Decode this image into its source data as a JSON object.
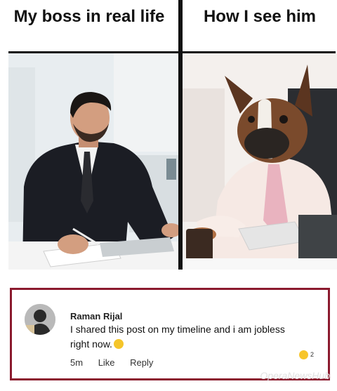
{
  "captions": {
    "left": "My boss in real life",
    "right": "How I see him"
  },
  "comment": {
    "author": "Raman Rijal",
    "text": "I shared this post on my timeline and i am jobless right now.",
    "time": "5m",
    "like_label": "Like",
    "reply_label": "Reply",
    "reaction_count": "2",
    "border_color": "#8b1a2e"
  },
  "watermark": {
    "text": "OperaNewsHub"
  },
  "images": {
    "left_photo": "businessman-in-suit-writing",
    "right_photo": "french-bulldog-in-shirt-and-tie"
  }
}
